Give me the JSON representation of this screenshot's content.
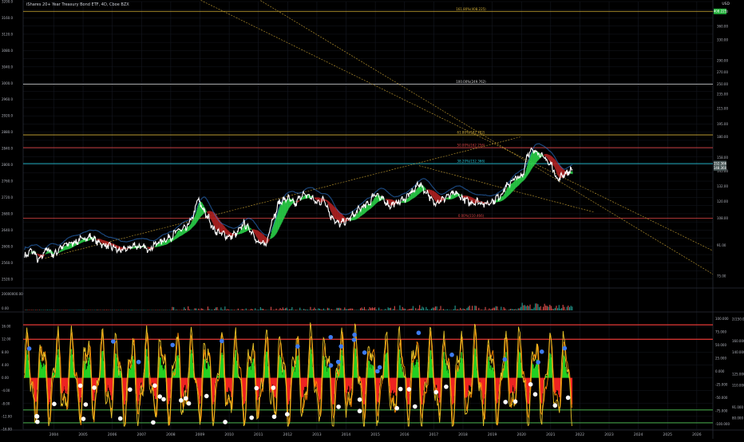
{
  "header": {
    "title": "iShares 20+ Year Treasury Bond ETF, 4D, Cboe BZX",
    "currency": "USD"
  },
  "colors": {
    "background": "#000000",
    "grid": "#151821",
    "text": "#b2b5be",
    "price": "#ffffff",
    "fib_gold": "#d4af37",
    "fib_red": "#e04646",
    "fib_teal": "#26c6da",
    "fib_white": "#d9d9d9",
    "ribbon_green": "#2bd44a",
    "ribbon_red": "#b22222",
    "blue_line": "#2f7fe0",
    "trend": "#c8a132",
    "osc_yellow": "#e8c228",
    "osc_orange": "#ff8a00",
    "hist_green": "#22d022",
    "hist_red": "#ee2222",
    "band_red": "#e53935",
    "band_green": "#43a047",
    "dot_blue": "#3d7bf0",
    "dot_white": "#ffffff",
    "label_green": "#24b23c",
    "label_gray": "#4c5a5a"
  },
  "chart_data": [
    {
      "type": "line",
      "panel": "price",
      "title": "iShares 20+ Year Treasury Bond ETF, 4D, Cboe BZX",
      "x": [
        2003.0,
        2003.25,
        2003.5,
        2003.75,
        2004.0,
        2004.25,
        2004.5,
        2004.75,
        2005.0,
        2005.25,
        2005.5,
        2005.75,
        2006.0,
        2006.25,
        2006.5,
        2006.75,
        2007.0,
        2007.25,
        2007.5,
        2007.75,
        2008.0,
        2008.25,
        2008.5,
        2008.75,
        2008.92,
        2009.0,
        2009.25,
        2009.5,
        2009.75,
        2010.0,
        2010.25,
        2010.5,
        2010.75,
        2011.0,
        2011.25,
        2011.5,
        2011.75,
        2012.0,
        2012.25,
        2012.5,
        2012.75,
        2013.0,
        2013.25,
        2013.5,
        2013.75,
        2014.0,
        2014.25,
        2014.5,
        2014.75,
        2015.0,
        2015.25,
        2015.5,
        2015.75,
        2016.0,
        2016.25,
        2016.5,
        2016.75,
        2017.0,
        2017.25,
        2017.5,
        2017.75,
        2018.0,
        2018.25,
        2018.5,
        2018.75,
        2019.0,
        2019.25,
        2019.5,
        2019.75,
        2020.0,
        2020.25,
        2020.5,
        2020.75,
        2021.0,
        2021.25,
        2021.5,
        2021.75
      ],
      "y": [
        85,
        88,
        83,
        89,
        86,
        90,
        92,
        93,
        95,
        96,
        93,
        91,
        90,
        88,
        89,
        91,
        90,
        89,
        92,
        94,
        96,
        100,
        101,
        108,
        121,
        118,
        109,
        100,
        98,
        96,
        98,
        104,
        100,
        92,
        92,
        108,
        120,
        122,
        118,
        125,
        124,
        119,
        121,
        109,
        104,
        106,
        110,
        115,
        118,
        126,
        121,
        117,
        119,
        122,
        127,
        134,
        127,
        119,
        121,
        124,
        126,
        122,
        119,
        120,
        118,
        120,
        124,
        132,
        138,
        140,
        163,
        165,
        158,
        151,
        138,
        143,
        146
      ],
      "ylim": [
        70,
        420
      ],
      "price_ticks": [
        75.0,
        91.0,
        108.0,
        120.0,
        132.0,
        145.0,
        158.0,
        180.0,
        195.0,
        215.0,
        235.0,
        250.0,
        270.0,
        290.0,
        330.0,
        360.0,
        395.0
      ],
      "left_ticks": [
        2520,
        2540,
        2560,
        2580,
        2600,
        2620,
        2640,
        2660,
        2680,
        2700,
        2720,
        2740,
        2760,
        2780,
        2800,
        2820,
        2840,
        2860,
        2880,
        2900,
        2920,
        2940,
        2960,
        2980,
        3000,
        3020,
        3040,
        3060,
        3080,
        3100,
        3120,
        3140,
        3160,
        3180,
        3200
      ],
      "left_tick_labels": [
        "2520.0",
        "",
        "2560.0",
        "",
        "2600.0",
        "",
        "2640.0",
        "",
        "2680.0",
        "",
        "2720.0",
        "",
        "2760.0",
        "",
        "2800.0",
        "",
        "2840.0",
        "",
        "2880.0",
        "",
        "2920.0",
        "",
        "2960.0",
        "",
        "3000.0",
        "",
        "3040.0",
        "",
        "3080.0",
        "",
        "3120.0",
        "",
        "3160.0",
        "",
        "3200.0"
      ],
      "fib_levels": [
        {
          "label": "161.80%(408.225)",
          "price": 395,
          "color": "#d4af37"
        },
        {
          "label": "100.00%(249.762)",
          "price": 250,
          "color": "#d9d9d9"
        },
        {
          "label": "61.80%(182.782)",
          "price": 182,
          "color": "#d4af37"
        },
        {
          "label": "50.00%(162.256)",
          "price": 168,
          "color": "#e04646"
        },
        {
          "label": "38.20%(152.366)",
          "price": 152,
          "color": "#26c6da"
        },
        {
          "label": "0.00%(110.466)",
          "price": 108,
          "color": "#e04646"
        }
      ],
      "current_labels": [
        {
          "text": "408.225",
          "price": 395,
          "color": "#24b23c"
        },
        {
          "text": "152.366",
          "price": 152,
          "color": "#4c5a5a"
        },
        {
          "text": "148.360",
          "price": 148,
          "color": "#4c5a5a"
        }
      ]
    },
    {
      "type": "bar",
      "panel": "volume",
      "title": "",
      "label_top": "20000000.00",
      "label_zero": "0.00"
    },
    {
      "type": "line",
      "panel": "oscillator",
      "title": "",
      "ylim": [
        -16,
        20
      ],
      "left_ticks": [
        16.0,
        12.0,
        8.0,
        4.0,
        0.0,
        -4.0,
        -8.0,
        -12.0,
        -16.0
      ],
      "left_tick_labels": [
        "16.00",
        "12.00",
        "8.00",
        "4.00",
        "0.00",
        "-4.00",
        "-8.00",
        "-12.00",
        "-16.00"
      ],
      "right_ticks_a": [
        100.0,
        75.0,
        50.0,
        25.0,
        0.0,
        -25.0,
        -50.0,
        -75.0,
        -100.0
      ],
      "right_ticks_a_labels": [
        "100.000",
        "75.000",
        "50.000",
        "25.000",
        "0.000",
        "-25.000",
        "-50.000",
        "-75.000",
        "-100.000"
      ],
      "right_ticks_b": [
        170,
        160,
        150,
        140,
        130,
        120,
        110,
        100,
        90,
        80
      ],
      "right_ticks_b_labels": [
        "2(150.0)",
        "",
        "160.000",
        "140.000",
        "",
        "125.000",
        "110.000",
        "",
        "91.000",
        "80.000"
      ],
      "upper_band": 16.5,
      "mid_band": 12.0,
      "lower_band": -10.0,
      "bottom_band": -14.0
    }
  ],
  "x_axis": {
    "years": [
      2004,
      2005,
      2006,
      2007,
      2008,
      2009,
      2010,
      2011,
      2012,
      2013,
      2014,
      2015,
      2016,
      2017,
      2018,
      2019,
      2020,
      2021,
      2022,
      2023,
      2024,
      2025,
      2026
    ],
    "labels": [
      "2004",
      "2005",
      "2006",
      "2007",
      "2008",
      "2009",
      "2010",
      "2011",
      "2012",
      "2013",
      "2014",
      "2015",
      "2016",
      "2017",
      "2018",
      "2019",
      "2020",
      "2021",
      "2022",
      "2023",
      "2024",
      "2025",
      "2026"
    ]
  }
}
